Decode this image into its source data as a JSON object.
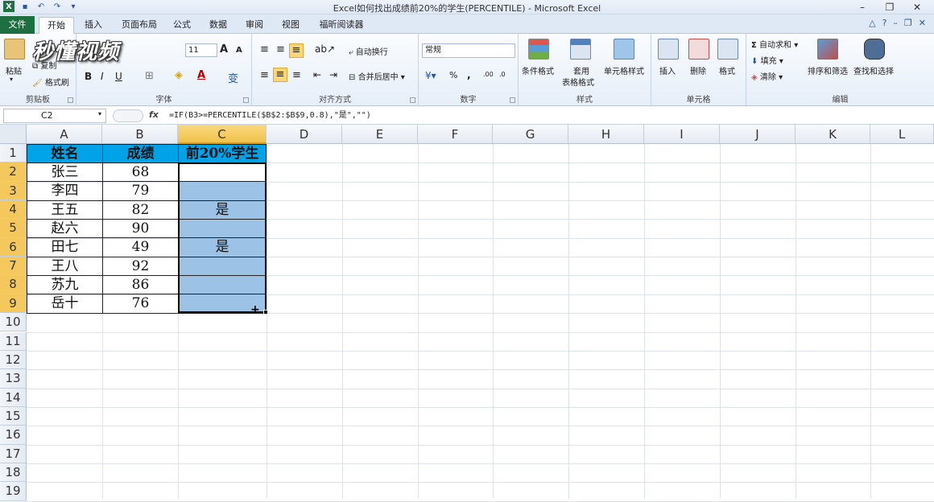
{
  "window": {
    "title": "Excel如何找出成绩前20%的学生(PERCENTILE)  -  Microsoft Excel"
  },
  "tabs": [
    "文件",
    "开始",
    "插入",
    "页面布局",
    "公式",
    "数据",
    "审阅",
    "视图",
    "福昕阅读器"
  ],
  "watermark": "秒懂视频",
  "ribbon": {
    "clipboard": {
      "paste": "粘贴",
      "copy": "复制",
      "format_painter": "格式刷",
      "label": "剪贴板"
    },
    "font": {
      "size": "11",
      "label": "字体",
      "grow": "A",
      "shrink": "A",
      "bold": "B",
      "italic": "I",
      "underline": "U",
      "phonetic": "变"
    },
    "alignment": {
      "wrap": "自动换行",
      "merge": "合并后居中",
      "label": "对齐方式"
    },
    "number": {
      "format": "常规",
      "percent": "%",
      "comma": ",",
      "label": "数字"
    },
    "styles": {
      "conditional": "条件格式",
      "table_fmt_1": "套用",
      "table_fmt_2": "表格格式",
      "cell_styles": "单元格样式",
      "label": "样式"
    },
    "cells": {
      "insert": "插入",
      "delete": "删除",
      "format": "格式",
      "label": "单元格"
    },
    "editing": {
      "autosum": "自动求和",
      "fill": "填充",
      "clear": "清除",
      "sort_filter": "排序和筛选",
      "find_select": "查找和选择",
      "label": "编辑"
    }
  },
  "formula_bar": {
    "name_box": "C2",
    "fx": "fx",
    "formula": "=IF(B3>=PERCENTILE($B$2:$B$9,0.8),\"是\",\"\")"
  },
  "columns": [
    "A",
    "B",
    "C",
    "D",
    "E",
    "F",
    "G",
    "H",
    "I",
    "J",
    "K",
    "L"
  ],
  "rows": [
    "1",
    "2",
    "3",
    "4",
    "5",
    "6",
    "7",
    "8",
    "9",
    "10",
    "11",
    "12",
    "13",
    "14",
    "15",
    "16",
    "17",
    "18",
    "19"
  ],
  "table": {
    "headers": [
      "姓名",
      "成绩",
      "前20%学生"
    ],
    "names": [
      "张三",
      "李四",
      "王五",
      "赵六",
      "田七",
      "王八",
      "苏九",
      "岳十"
    ],
    "scores": [
      "68",
      "79",
      "82",
      "90",
      "49",
      "92",
      "86",
      "76"
    ],
    "result": [
      "",
      "",
      "是",
      "",
      "是",
      "",
      "",
      ""
    ]
  },
  "cursor": "+"
}
